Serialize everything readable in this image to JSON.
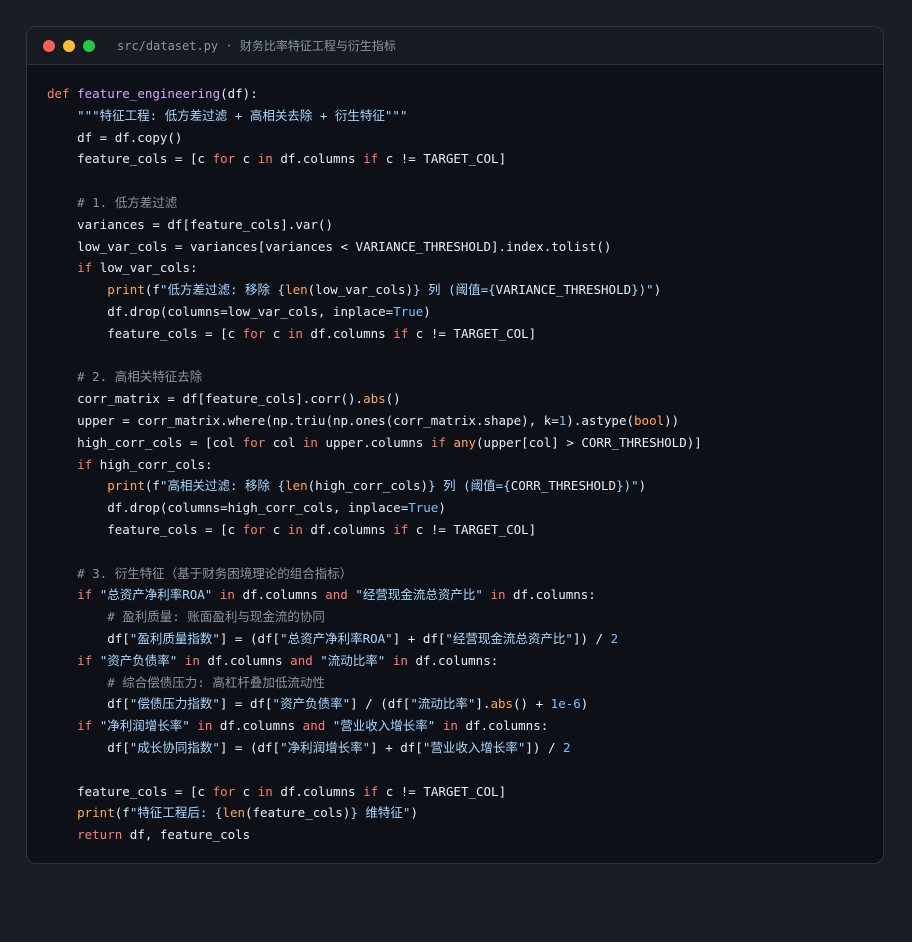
{
  "window": {
    "title": "src/dataset.py · 财务比率特征工程与衍生指标",
    "controls": {
      "close_color": "#ff5f56",
      "minimize_color": "#ffbd2e",
      "maximize_color": "#27c93f"
    }
  },
  "code_lines": [
    [
      [
        "kw",
        "def "
      ],
      [
        "fn",
        "feature_engineering"
      ],
      [
        "plain",
        "(df):"
      ]
    ],
    [
      [
        "plain",
        "    "
      ],
      [
        "str",
        "\"\"\"特征工程: 低方差过滤 + 高相关去除 + 衍生特征\"\"\""
      ]
    ],
    [
      [
        "plain",
        "    df = df.copy()"
      ]
    ],
    [
      [
        "plain",
        "    feature_cols = [c "
      ],
      [
        "kw",
        "for"
      ],
      [
        "plain",
        " c "
      ],
      [
        "kw",
        "in"
      ],
      [
        "plain",
        " df.columns "
      ],
      [
        "kw",
        "if"
      ],
      [
        "plain",
        " c != TARGET_COL]"
      ]
    ],
    [
      [
        "plain",
        ""
      ]
    ],
    [
      [
        "plain",
        "    "
      ],
      [
        "cm",
        "# 1. 低方差过滤"
      ]
    ],
    [
      [
        "plain",
        "    variances = df[feature_cols].var()"
      ]
    ],
    [
      [
        "plain",
        "    low_var_cols = variances[variances < VARIANCE_THRESHOLD].index.tolist()"
      ]
    ],
    [
      [
        "plain",
        "    "
      ],
      [
        "kw",
        "if"
      ],
      [
        "plain",
        " low_var_cols:"
      ]
    ],
    [
      [
        "plain",
        "        "
      ],
      [
        "bi",
        "print"
      ],
      [
        "plain",
        "(f"
      ],
      [
        "str",
        "\"低方差过滤: 移除 {"
      ],
      [
        "bi",
        "len"
      ],
      [
        "plain",
        "(low_var_cols)"
      ],
      [
        "str",
        "} 列 (阈值={"
      ],
      [
        "plain",
        "VARIANCE_THRESHOLD"
      ],
      [
        "str",
        "})\""
      ],
      [
        "plain",
        ")"
      ]
    ],
    [
      [
        "plain",
        "        df.drop(columns=low_var_cols, inplace="
      ],
      [
        "num",
        "True"
      ],
      [
        "plain",
        ")"
      ]
    ],
    [
      [
        "plain",
        "        feature_cols = [c "
      ],
      [
        "kw",
        "for"
      ],
      [
        "plain",
        " c "
      ],
      [
        "kw",
        "in"
      ],
      [
        "plain",
        " df.columns "
      ],
      [
        "kw",
        "if"
      ],
      [
        "plain",
        " c != TARGET_COL]"
      ]
    ],
    [
      [
        "plain",
        ""
      ]
    ],
    [
      [
        "plain",
        "    "
      ],
      [
        "cm",
        "# 2. 高相关特征去除"
      ]
    ],
    [
      [
        "plain",
        "    corr_matrix = df[feature_cols].corr()."
      ],
      [
        "bi",
        "abs"
      ],
      [
        "plain",
        "()"
      ]
    ],
    [
      [
        "plain",
        "    upper = corr_matrix.where(np.triu(np.ones(corr_matrix.shape), k="
      ],
      [
        "num",
        "1"
      ],
      [
        "plain",
        ").astype("
      ],
      [
        "bi",
        "bool"
      ],
      [
        "plain",
        "))"
      ]
    ],
    [
      [
        "plain",
        "    high_corr_cols = [col "
      ],
      [
        "kw",
        "for"
      ],
      [
        "plain",
        " col "
      ],
      [
        "kw",
        "in"
      ],
      [
        "plain",
        " upper.columns "
      ],
      [
        "kw",
        "if"
      ],
      [
        "plain",
        " "
      ],
      [
        "bi",
        "any"
      ],
      [
        "plain",
        "(upper[col] > CORR_THRESHOLD)]"
      ]
    ],
    [
      [
        "plain",
        "    "
      ],
      [
        "kw",
        "if"
      ],
      [
        "plain",
        " high_corr_cols:"
      ]
    ],
    [
      [
        "plain",
        "        "
      ],
      [
        "bi",
        "print"
      ],
      [
        "plain",
        "(f"
      ],
      [
        "str",
        "\"高相关过滤: 移除 {"
      ],
      [
        "bi",
        "len"
      ],
      [
        "plain",
        "(high_corr_cols)"
      ],
      [
        "str",
        "} 列 (阈值={"
      ],
      [
        "plain",
        "CORR_THRESHOLD"
      ],
      [
        "str",
        "})\""
      ],
      [
        "plain",
        ")"
      ]
    ],
    [
      [
        "plain",
        "        df.drop(columns=high_corr_cols, inplace="
      ],
      [
        "num",
        "True"
      ],
      [
        "plain",
        ")"
      ]
    ],
    [
      [
        "plain",
        "        feature_cols = [c "
      ],
      [
        "kw",
        "for"
      ],
      [
        "plain",
        " c "
      ],
      [
        "kw",
        "in"
      ],
      [
        "plain",
        " df.columns "
      ],
      [
        "kw",
        "if"
      ],
      [
        "plain",
        " c != TARGET_COL]"
      ]
    ],
    [
      [
        "plain",
        ""
      ]
    ],
    [
      [
        "plain",
        "    "
      ],
      [
        "cm",
        "# 3. 衍生特征（基于财务困境理论的组合指标）"
      ]
    ],
    [
      [
        "plain",
        "    "
      ],
      [
        "kw",
        "if"
      ],
      [
        "plain",
        " "
      ],
      [
        "str",
        "\"总资产净利率ROA\""
      ],
      [
        "plain",
        " "
      ],
      [
        "kw",
        "in"
      ],
      [
        "plain",
        " df.columns "
      ],
      [
        "kw",
        "and"
      ],
      [
        "plain",
        " "
      ],
      [
        "str",
        "\"经营现金流总资产比\""
      ],
      [
        "plain",
        " "
      ],
      [
        "kw",
        "in"
      ],
      [
        "plain",
        " df.columns:"
      ]
    ],
    [
      [
        "plain",
        "        "
      ],
      [
        "cm",
        "# 盈利质量: 账面盈利与现金流的协同"
      ]
    ],
    [
      [
        "plain",
        "        df["
      ],
      [
        "str",
        "\"盈利质量指数\""
      ],
      [
        "plain",
        "] = (df["
      ],
      [
        "str",
        "\"总资产净利率ROA\""
      ],
      [
        "plain",
        "] + df["
      ],
      [
        "str",
        "\"经营现金流总资产比\""
      ],
      [
        "plain",
        "]) / "
      ],
      [
        "num",
        "2"
      ]
    ],
    [
      [
        "plain",
        "    "
      ],
      [
        "kw",
        "if"
      ],
      [
        "plain",
        " "
      ],
      [
        "str",
        "\"资产负债率\""
      ],
      [
        "plain",
        " "
      ],
      [
        "kw",
        "in"
      ],
      [
        "plain",
        " df.columns "
      ],
      [
        "kw",
        "and"
      ],
      [
        "plain",
        " "
      ],
      [
        "str",
        "\"流动比率\""
      ],
      [
        "plain",
        " "
      ],
      [
        "kw",
        "in"
      ],
      [
        "plain",
        " df.columns:"
      ]
    ],
    [
      [
        "plain",
        "        "
      ],
      [
        "cm",
        "# 综合偿债压力: 高杠杆叠加低流动性"
      ]
    ],
    [
      [
        "plain",
        "        df["
      ],
      [
        "str",
        "\"偿债压力指数\""
      ],
      [
        "plain",
        "] = df["
      ],
      [
        "str",
        "\"资产负债率\""
      ],
      [
        "plain",
        "] / (df["
      ],
      [
        "str",
        "\"流动比率\""
      ],
      [
        "plain",
        "]."
      ],
      [
        "bi",
        "abs"
      ],
      [
        "plain",
        "() + "
      ],
      [
        "num",
        "1e-6"
      ],
      [
        "plain",
        ")"
      ]
    ],
    [
      [
        "plain",
        "    "
      ],
      [
        "kw",
        "if"
      ],
      [
        "plain",
        " "
      ],
      [
        "str",
        "\"净利润增长率\""
      ],
      [
        "plain",
        " "
      ],
      [
        "kw",
        "in"
      ],
      [
        "plain",
        " df.columns "
      ],
      [
        "kw",
        "and"
      ],
      [
        "plain",
        " "
      ],
      [
        "str",
        "\"营业收入增长率\""
      ],
      [
        "plain",
        " "
      ],
      [
        "kw",
        "in"
      ],
      [
        "plain",
        " df.columns:"
      ]
    ],
    [
      [
        "plain",
        "        df["
      ],
      [
        "str",
        "\"成长协同指数\""
      ],
      [
        "plain",
        "] = (df["
      ],
      [
        "str",
        "\"净利润增长率\""
      ],
      [
        "plain",
        "] + df["
      ],
      [
        "str",
        "\"营业收入增长率\""
      ],
      [
        "plain",
        "]) / "
      ],
      [
        "num",
        "2"
      ]
    ],
    [
      [
        "plain",
        ""
      ]
    ],
    [
      [
        "plain",
        "    feature_cols = [c "
      ],
      [
        "kw",
        "for"
      ],
      [
        "plain",
        " c "
      ],
      [
        "kw",
        "in"
      ],
      [
        "plain",
        " df.columns "
      ],
      [
        "kw",
        "if"
      ],
      [
        "plain",
        " c != TARGET_COL]"
      ]
    ],
    [
      [
        "plain",
        "    "
      ],
      [
        "bi",
        "print"
      ],
      [
        "plain",
        "(f"
      ],
      [
        "str",
        "\"特征工程后: {"
      ],
      [
        "bi",
        "len"
      ],
      [
        "plain",
        "(feature_cols)"
      ],
      [
        "str",
        "} 维特征\""
      ],
      [
        "plain",
        ")"
      ]
    ],
    [
      [
        "plain",
        "    "
      ],
      [
        "kw",
        "return"
      ],
      [
        "plain",
        " df, feature_cols"
      ]
    ]
  ]
}
